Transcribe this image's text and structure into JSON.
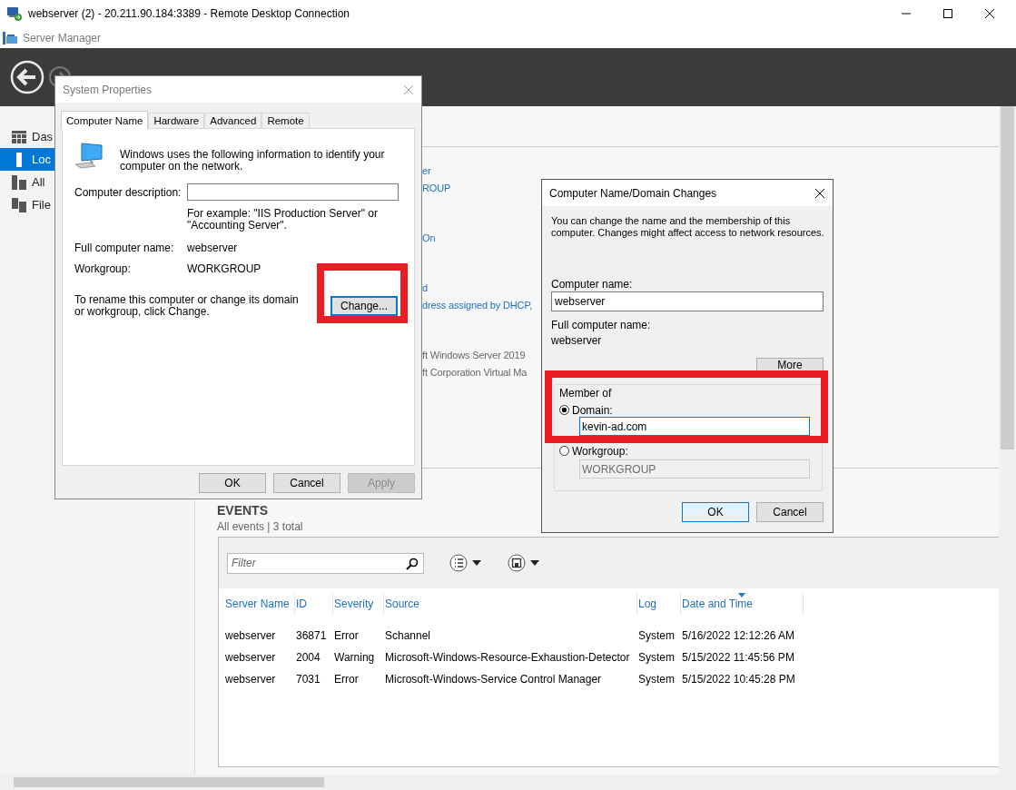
{
  "rdp_window": {
    "title": "webserver (2) - 20.211.90.184:3389 - Remote Desktop Connection"
  },
  "app": {
    "title": "Server Manager"
  },
  "sidebar": {
    "items": [
      {
        "label": "Das",
        "kind": "dashboard",
        "selected": false
      },
      {
        "label": "Loc",
        "kind": "local",
        "selected": true
      },
      {
        "label": "All",
        "kind": "servers",
        "selected": false
      },
      {
        "label": "File",
        "kind": "files",
        "selected": false
      }
    ]
  },
  "properties": {
    "groups": [
      [
        {
          "text": "er",
          "kind": "link"
        },
        {
          "text": "ROUP",
          "kind": "link"
        }
      ],
      [
        {
          "text": "On",
          "kind": "link"
        }
      ],
      [
        {
          "text": "d",
          "kind": "link"
        },
        {
          "text": "dress assigned by DHCP,",
          "kind": "link"
        }
      ],
      [
        {
          "text": "ft Windows Server 2019",
          "kind": "text"
        },
        {
          "text": "ft Corporation Virtual Ma",
          "kind": "text"
        }
      ]
    ]
  },
  "events": {
    "title": "EVENTS",
    "subtitle": "All events | 3 total",
    "filter": {
      "placeholder": "Filter"
    },
    "columns": [
      {
        "label": "Server Name",
        "sorted": false
      },
      {
        "label": "ID",
        "sorted": false
      },
      {
        "label": "Severity",
        "sorted": false
      },
      {
        "label": "Source",
        "sorted": false
      },
      {
        "label": "Log",
        "sorted": false
      },
      {
        "label": "Date and Time",
        "sorted": true
      }
    ],
    "rows": [
      [
        "webserver",
        "36871",
        "Error",
        "Schannel",
        "System",
        "5/16/2022 12:12:26 AM"
      ],
      [
        "webserver",
        "2004",
        "Warning",
        "Microsoft-Windows-Resource-Exhaustion-Detector",
        "System",
        "5/15/2022 11:45:56 PM"
      ],
      [
        "webserver",
        "7031",
        "Error",
        "Microsoft-Windows-Service Control Manager",
        "System",
        "5/15/2022 10:45:28 PM"
      ]
    ]
  },
  "system_properties": {
    "title": "System Properties",
    "tabs": [
      {
        "label": "Computer Name",
        "selected": true
      },
      {
        "label": "Hardware",
        "selected": false
      },
      {
        "label": "Advanced",
        "selected": false
      },
      {
        "label": "Remote",
        "selected": false
      }
    ],
    "intro": "Windows uses the following information to identify your computer on the network.",
    "description_label": "Computer description:",
    "example": "For example: \"IIS Production Server\" or \"Accounting Server\".",
    "fields": [
      {
        "label": "Full computer name:",
        "value": "webserver"
      },
      {
        "label": "Workgroup:",
        "value": "WORKGROUP"
      }
    ],
    "rename_text": "To rename this computer or change its domain or workgroup, click Change.",
    "change_button": "Change...",
    "buttons": [
      {
        "label": "OK",
        "disabled": false
      },
      {
        "label": "Cancel",
        "disabled": false
      },
      {
        "label": "Apply",
        "disabled": true
      }
    ]
  },
  "name_changes": {
    "title": "Computer Name/Domain Changes",
    "intro": "You can change the name and the membership of this computer. Changes might affect access to network resources.",
    "computer_name_label": "Computer name:",
    "computer_name": "webserver",
    "full_name_label": "Full computer name:",
    "full_name": "webserver",
    "more_button": "More",
    "member_of": {
      "legend": "Member of",
      "options": [
        {
          "label": "Domain:",
          "selected": true,
          "value": "kevin-ad.com"
        },
        {
          "label": "Workgroup:",
          "selected": false,
          "value": "WORKGROUP"
        }
      ]
    },
    "buttons": [
      {
        "label": "OK",
        "default": true
      },
      {
        "label": "Cancel",
        "default": false
      }
    ]
  }
}
